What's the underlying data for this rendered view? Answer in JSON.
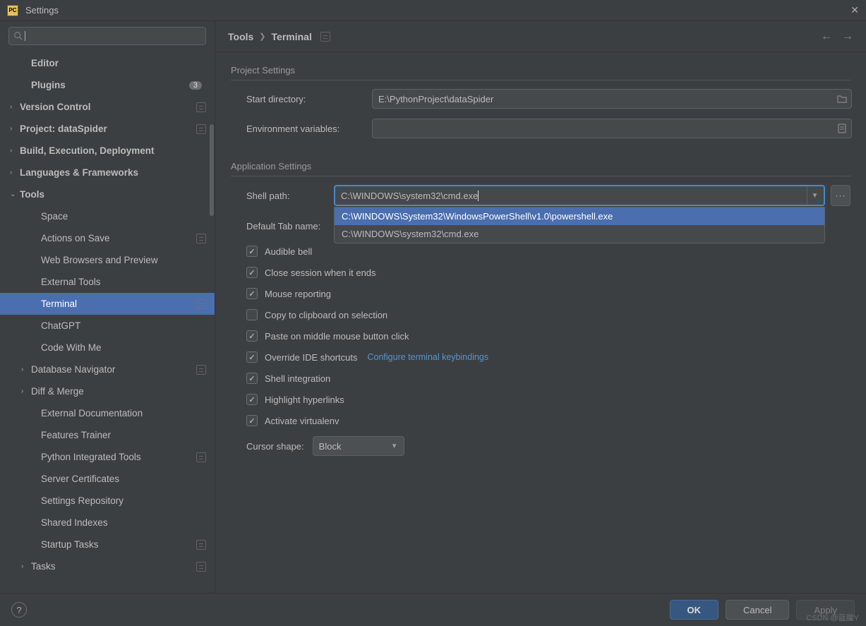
{
  "window": {
    "title": "Settings"
  },
  "search": {
    "value": ""
  },
  "sidebar": {
    "items": [
      {
        "label": "Editor",
        "kind": "leaf",
        "indent": 1,
        "bold": true
      },
      {
        "label": "Plugins",
        "kind": "leaf",
        "indent": 1,
        "bold": true,
        "badge": "3"
      },
      {
        "label": "Version Control",
        "kind": "collapsed",
        "indent": 0,
        "bold": true,
        "projIcon": true
      },
      {
        "label": "Project: dataSpider",
        "kind": "collapsed",
        "indent": 0,
        "bold": true,
        "projIcon": true
      },
      {
        "label": "Build, Execution, Deployment",
        "kind": "collapsed",
        "indent": 0,
        "bold": true
      },
      {
        "label": "Languages & Frameworks",
        "kind": "collapsed",
        "indent": 0,
        "bold": true
      },
      {
        "label": "Tools",
        "kind": "expanded",
        "indent": 0,
        "bold": true
      },
      {
        "label": "Space",
        "kind": "leaf",
        "indent": 2
      },
      {
        "label": "Actions on Save",
        "kind": "leaf",
        "indent": 2,
        "projIcon": true
      },
      {
        "label": "Web Browsers and Preview",
        "kind": "leaf",
        "indent": 2
      },
      {
        "label": "External Tools",
        "kind": "leaf",
        "indent": 2
      },
      {
        "label": "Terminal",
        "kind": "leaf",
        "indent": 2,
        "selected": true,
        "projIcon": true
      },
      {
        "label": "ChatGPT",
        "kind": "leaf",
        "indent": 2
      },
      {
        "label": "Code With Me",
        "kind": "leaf",
        "indent": 2
      },
      {
        "label": "Database Navigator",
        "kind": "collapsed",
        "indent": 1,
        "projIcon": true
      },
      {
        "label": "Diff & Merge",
        "kind": "collapsed",
        "indent": 1
      },
      {
        "label": "External Documentation",
        "kind": "leaf",
        "indent": 2
      },
      {
        "label": "Features Trainer",
        "kind": "leaf",
        "indent": 2
      },
      {
        "label": "Python Integrated Tools",
        "kind": "leaf",
        "indent": 2,
        "projIcon": true
      },
      {
        "label": "Server Certificates",
        "kind": "leaf",
        "indent": 2
      },
      {
        "label": "Settings Repository",
        "kind": "leaf",
        "indent": 2
      },
      {
        "label": "Shared Indexes",
        "kind": "leaf",
        "indent": 2
      },
      {
        "label": "Startup Tasks",
        "kind": "leaf",
        "indent": 2,
        "projIcon": true
      },
      {
        "label": "Tasks",
        "kind": "collapsed",
        "indent": 1,
        "projIcon": true
      }
    ]
  },
  "breadcrumb": {
    "root": "Tools",
    "leaf": "Terminal"
  },
  "project_settings": {
    "heading": "Project Settings",
    "start_dir_label": "Start directory:",
    "start_dir_value": "E:\\PythonProject\\dataSpider",
    "env_label": "Environment variables:",
    "env_value": ""
  },
  "app_settings": {
    "heading": "Application Settings",
    "shell_path_label": "Shell path:",
    "shell_path_value": "C:\\WINDOWS\\system32\\cmd.exe",
    "shell_path_options": [
      "C:\\WINDOWS\\System32\\WindowsPowerShell\\v1.0\\powershell.exe",
      "C:\\WINDOWS\\system32\\cmd.exe"
    ],
    "default_tab_label": "Default Tab name:",
    "default_tab_value": "",
    "checkboxes": [
      {
        "label": "Audible bell",
        "checked": true
      },
      {
        "label": "Close session when it ends",
        "checked": true
      },
      {
        "label": "Mouse reporting",
        "checked": true
      },
      {
        "label": "Copy to clipboard on selection",
        "checked": false
      },
      {
        "label": "Paste on middle mouse button click",
        "checked": true
      },
      {
        "label": "Override IDE shortcuts",
        "checked": true,
        "link": "Configure terminal keybindings"
      },
      {
        "label": "Shell integration",
        "checked": true
      },
      {
        "label": "Highlight hyperlinks",
        "checked": true
      },
      {
        "label": "Activate virtualenv",
        "checked": true
      }
    ],
    "cursor_shape_label": "Cursor shape:",
    "cursor_shape_value": "Block"
  },
  "footer": {
    "ok": "OK",
    "cancel": "Cancel",
    "apply": "Apply"
  },
  "watermark": "CSDN @蓝魔Y"
}
